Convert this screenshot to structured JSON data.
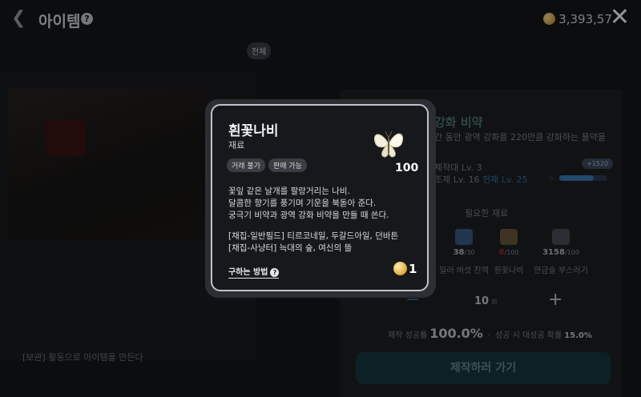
{
  "header": {
    "back_icon": "chevron-left-icon",
    "title": "아이템",
    "help_glyph": "?",
    "currency_amount": "3,393,57",
    "currency_icon": "gold-coin-icon",
    "close_glyph": "✕"
  },
  "filters": {
    "tabs": [
      "전체",
      "",
      "",
      "",
      "",
      ""
    ],
    "active_index": 0
  },
  "left": {
    "hint": "[보관] 활동으로 아이템을 만든다"
  },
  "potion": {
    "name": "강화 비약",
    "description": "간 동안 광역 강화를 220만큼 강화하는 물약을",
    "req_line1": "제작대 Lv. 3",
    "req_line2_prefix": "조제 Lv. 16",
    "req_line2_current": "현재 Lv. 25",
    "progress_tip": "+1520",
    "progress_fraction": 0.72
  },
  "materials": {
    "title": "필요한 재료",
    "items": [
      {
        "count": "38",
        "need": "/30",
        "name": "밀러 버섯 진액",
        "lack": false,
        "color": "#3a5d86"
      },
      {
        "count": "8",
        "need": "/100",
        "name": "흰꽃나비",
        "lack": true,
        "color": "#6b5a3e"
      },
      {
        "count": "3158",
        "need": "/100",
        "name": "연금술 부스러기",
        "lack": false,
        "color": "#4a4f57"
      }
    ]
  },
  "stepper": {
    "minus_glyph": "−",
    "quantity": "10",
    "unit": "회",
    "plus_glyph": "+"
  },
  "success": {
    "label": "제작 성공률",
    "rate": "100.0%",
    "great_label": "성공 시 대성공 확률",
    "great_rate": "15.0%"
  },
  "craft_button": "제작하러 가기",
  "item_card": {
    "name": "흰꽃나비",
    "category": "재료",
    "tags": [
      "거래 불가",
      "판매 가능"
    ],
    "icon": "white-butterfly-icon",
    "count": "100",
    "description": [
      "꽃잎 같은 날개를 팔랑거리는 나비.",
      "달콤한 향기를 풍기며 기운을 북돋아 준다.",
      "궁극기 비약과 광역 강화 비약을 만들 때 쓴다.",
      "",
      "[채집-일반필드] 티르코네일, 두갈드아일, 던바튼",
      "[채집-사냥터] 늑대의 숲, 여신의 뜰"
    ],
    "how_to_get": "구하는 방법",
    "price": "1"
  }
}
